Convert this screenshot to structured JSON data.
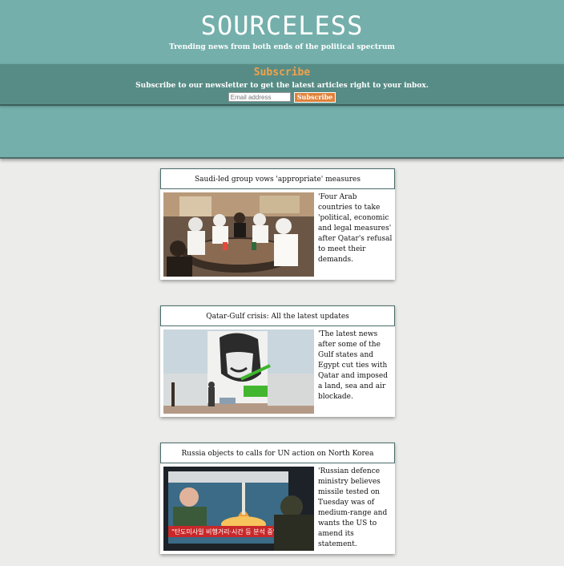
{
  "site": {
    "title": "SOURCELESS",
    "tagline": "Trending news from both ends of the political spectrum"
  },
  "subscribe": {
    "heading": "Subscribe",
    "text": "Subscribe to our newsletter to get the latest articles right to your inbox.",
    "email_placeholder": "Email address",
    "button_label": "Subscribe"
  },
  "articles": [
    {
      "title": "Saudi-led group vows 'appropriate' measures",
      "excerpt": "'Four Arab countries to take 'political, economic and legal measures' after Qatar's refusal to meet their demands."
    },
    {
      "title": "Qatar-Gulf crisis: All the latest updates",
      "excerpt": "'The latest news after some of the Gulf states and Egypt cut ties with Qatar and imposed a land, sea and air blockade."
    },
    {
      "title": "Russia objects to calls for UN action on North Korea",
      "excerpt": "'Russian defence ministry believes missile tested on Tuesday was of medium-range and wants the US to amend its statement."
    }
  ],
  "image3": {
    "tv_banner": "\"탄도미사일 비행거리·시간 등 분석 중\""
  },
  "colors": {
    "header_bg": "#74afab",
    "band_bg": "#578c86",
    "accent": "#f2a24a",
    "button_bg": "#e0813a",
    "page_bg": "#ececea"
  }
}
